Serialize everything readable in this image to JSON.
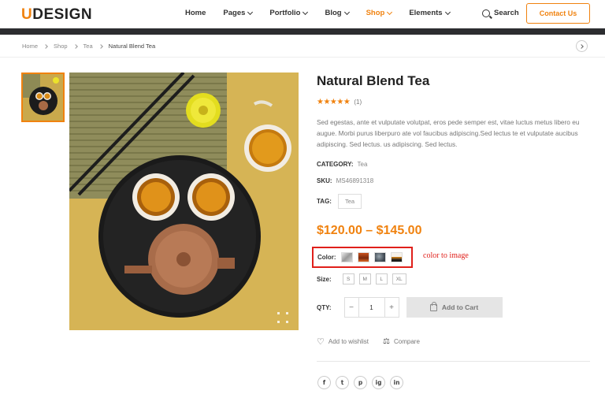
{
  "header": {
    "logo_first": "U",
    "logo_rest": "DESIGN",
    "nav": [
      {
        "label": "Home",
        "dropdown": false,
        "active": false
      },
      {
        "label": "Pages",
        "dropdown": true,
        "active": false
      },
      {
        "label": "Portfolio",
        "dropdown": true,
        "active": false
      },
      {
        "label": "Blog",
        "dropdown": true,
        "active": false
      },
      {
        "label": "Shop",
        "dropdown": true,
        "active": true
      },
      {
        "label": "Elements",
        "dropdown": true,
        "active": false
      }
    ],
    "search_label": "Search",
    "contact_label": "Contact Us"
  },
  "breadcrumb": [
    "Home",
    "Shop",
    "Tea",
    "Natural Blend Tea"
  ],
  "product": {
    "title": "Natural Blend Tea",
    "rating": 5,
    "review_count": "(1)",
    "description": "Sed egestas, ante et vulputate volutpat, eros pede semper est, vitae luctus metus libero eu augue. Morbi purus liberpuro ate vol faucibus adipiscing.Sed lectus te et vulputate aucibus adipiscing. Sed lectus. us adipiscing. Sed lectus.",
    "category_label": "CATEGORY:",
    "category_value": "Tea",
    "sku_label": "SKU:",
    "sku_value": "MS46891318",
    "tag_label": "TAG:",
    "tag_value": "Tea",
    "price": "$120.00 – $145.00",
    "color_label": "Color:",
    "color_swatches": [
      "swatch-silver",
      "swatch-rust",
      "swatch-slate",
      "swatch-sunset"
    ],
    "color_note": "color to image",
    "size_label": "Size:",
    "sizes": [
      "S",
      "M",
      "L",
      "XL"
    ],
    "qty_label": "QTY:",
    "qty_minus": "−",
    "qty_value": "1",
    "qty_plus": "+",
    "add_to_cart": "Add to Cart",
    "wishlist": "Add to wishlist",
    "compare": "Compare",
    "social": [
      "f",
      "t",
      "p",
      "ig",
      "in"
    ]
  },
  "colors": {
    "accent": "#f0820f",
    "annotation": "#e0201b",
    "dark_bar": "#2c2d30"
  }
}
